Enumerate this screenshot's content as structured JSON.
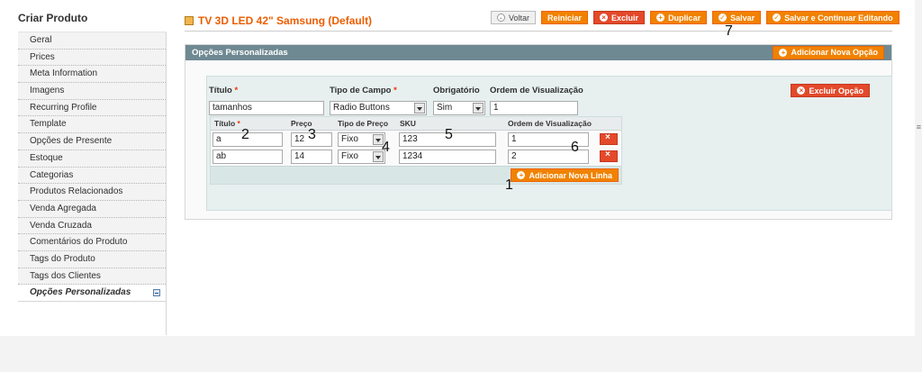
{
  "sidebar": {
    "title": "Criar Produto",
    "items": [
      "Geral",
      "Prices",
      "Meta Information",
      "Imagens",
      "Recurring Profile",
      "Template",
      "Opções de Presente",
      "Estoque",
      "Categorias",
      "Produtos Relacionados",
      "Venda Agregada",
      "Venda Cruzada",
      "Comentários do Produto",
      "Tags do Produto",
      "Tags dos Clientes",
      "Opções Personalizadas"
    ]
  },
  "header": {
    "title": "TV 3D LED 42\" Samsung (Default)",
    "buttons": {
      "back": "Voltar",
      "reset": "Reiniciar",
      "delete": "Excluir",
      "duplicate": "Duplicar",
      "save": "Salvar",
      "save_continue": "Salvar e Continuar Editando"
    }
  },
  "panel": {
    "title": "Opções Personalizadas",
    "add_option": "Adicionar Nova Opção",
    "option": {
      "title_label": "Título",
      "title_value": "tamanhos",
      "field_type_label": "Tipo de Campo",
      "field_type_value": "Radio Buttons",
      "required_label": "Obrigatório",
      "required_value": "Sim",
      "sort_label": "Ordem de Visualização",
      "sort_value": "1",
      "delete_option": "Excluir Opção"
    },
    "rows_table": {
      "headers": [
        "Título",
        "Preço",
        "Tipo de Preço",
        "SKU",
        "Ordem de Visualização"
      ],
      "rows": [
        {
          "title": "a",
          "price": "12",
          "price_type": "Fixo",
          "sku": "123",
          "sort": "1"
        },
        {
          "title": "ab",
          "price": "14",
          "price_type": "Fixo",
          "sku": "1234",
          "sort": "2"
        }
      ],
      "add_row": "Adicionar Nova Linha"
    }
  },
  "annotations": [
    "1",
    "2",
    "3",
    "4",
    "5",
    "6",
    "7"
  ],
  "colors": {
    "accent": "#f18200",
    "danger": "#e3492a",
    "title": "#eb5e00",
    "panel_header": "#6f8992"
  }
}
